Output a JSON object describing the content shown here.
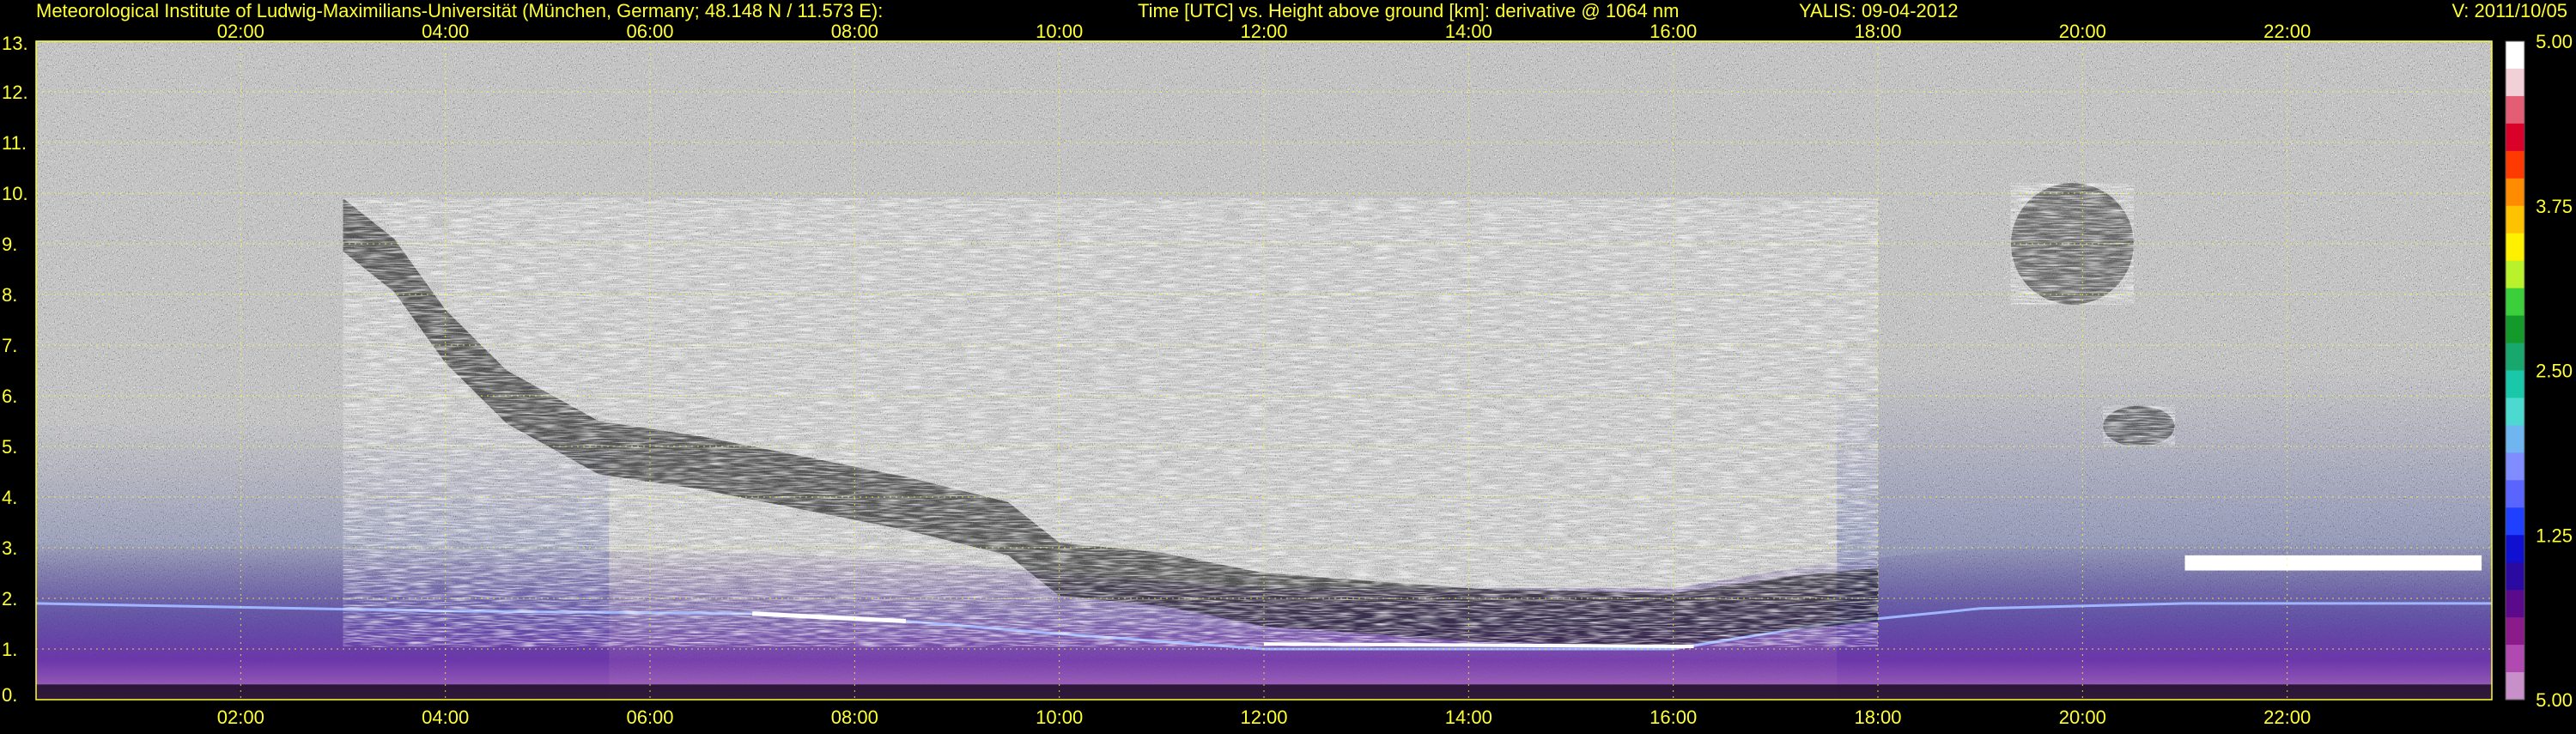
{
  "header": {
    "institute": "Meteorological Institute of Ludwig-Maximilians-Universität (München, Germany; 48.148 N / 11.573 E):",
    "title": "Time [UTC] vs. Height above ground [km]: derivative @ 1064 nm",
    "instrument": "YALIS: 09-04-2012",
    "version": "V: 2011/10/05"
  },
  "colors": {
    "label_yellow": "#ffff33",
    "background": "#000000",
    "plot_noise_gray": "#8a8a8a",
    "aerosol_purple": "#7a3fb0",
    "cloud_white": "#ffffff",
    "grid": "#ffff33"
  },
  "chart_data": {
    "type": "heatmap",
    "title": "Time [UTC] vs. Height above ground [km]: derivative @ 1064 nm",
    "xlabel": "Time [UTC]",
    "ylabel": "Height above ground [km]",
    "xlim": [
      0.0,
      24.0
    ],
    "ylim": [
      0,
      13
    ],
    "x_ticks": [
      "02:00",
      "04:00",
      "06:00",
      "08:00",
      "10:00",
      "12:00",
      "14:00",
      "16:00",
      "18:00",
      "20:00",
      "22:00"
    ],
    "x_tick_values": [
      2,
      4,
      6,
      8,
      10,
      12,
      14,
      16,
      18,
      20,
      22
    ],
    "y_ticks": [
      "0.",
      "1.",
      "2.",
      "3.",
      "4.",
      "5.",
      "6.",
      "7.",
      "8.",
      "9.",
      "10.",
      "11.",
      "12.",
      "13."
    ],
    "y_tick_values": [
      0,
      1,
      2,
      3,
      4,
      5,
      6,
      7,
      8,
      9,
      10,
      11,
      12,
      13
    ],
    "grid": true,
    "colorbar": {
      "labels": [
        "5.00",
        "3.75",
        "2.50",
        "1.25",
        "5.00"
      ],
      "colors": [
        "#ffffff",
        "#f2d0d8",
        "#e35e74",
        "#d9002a",
        "#ff3a00",
        "#ff8c00",
        "#ffc200",
        "#fff000",
        "#b9f22a",
        "#3ccf3c",
        "#149a2a",
        "#18a86e",
        "#19c8a8",
        "#4bd9d0",
        "#6fb6f0",
        "#7f8dff",
        "#5a64ff",
        "#2040ff",
        "#1010d0",
        "#2a0aa0",
        "#5a0a8a",
        "#8b1a8b",
        "#b04ab0",
        "#c890c8"
      ]
    },
    "features": {
      "aerosol_layer_top_km": [
        {
          "x": 0.0,
          "y": 1.9
        },
        {
          "x": 4.0,
          "y": 1.75
        },
        {
          "x": 7.0,
          "y": 1.7
        },
        {
          "x": 8.5,
          "y": 1.55
        },
        {
          "x": 10.0,
          "y": 1.3
        },
        {
          "x": 12.0,
          "y": 1.0
        },
        {
          "x": 14.0,
          "y": 1.0
        },
        {
          "x": 16.0,
          "y": 1.0
        },
        {
          "x": 17.5,
          "y": 1.5
        },
        {
          "x": 19.0,
          "y": 1.8
        },
        {
          "x": 21.0,
          "y": 1.9
        },
        {
          "x": 24.0,
          "y": 1.9
        }
      ],
      "descending_cloud_base_km": [
        {
          "x": 3.0,
          "y": 9.0
        },
        {
          "x": 3.5,
          "y": 8.2
        },
        {
          "x": 4.0,
          "y": 6.8
        },
        {
          "x": 4.6,
          "y": 5.6
        },
        {
          "x": 5.5,
          "y": 4.6
        },
        {
          "x": 6.5,
          "y": 4.3
        },
        {
          "x": 7.5,
          "y": 3.9
        },
        {
          "x": 8.5,
          "y": 3.5
        },
        {
          "x": 9.5,
          "y": 3.0
        },
        {
          "x": 10.0,
          "y": 2.2
        },
        {
          "x": 11.0,
          "y": 2.0
        },
        {
          "x": 12.0,
          "y": 1.6
        },
        {
          "x": 14.0,
          "y": 1.3
        },
        {
          "x": 16.0,
          "y": 1.2
        },
        {
          "x": 17.0,
          "y": 1.5
        },
        {
          "x": 18.0,
          "y": 1.7
        }
      ],
      "high_cloud_patches": [
        {
          "x_start": 19.3,
          "x_end": 20.5,
          "y_bottom": 7.8,
          "y_top": 10.2
        },
        {
          "x_start": 20.2,
          "x_end": 20.9,
          "y_bottom": 5.0,
          "y_top": 5.8
        }
      ],
      "late_cloud_layer": {
        "x_start": 21.0,
        "x_end": 23.9,
        "y": 2.7
      }
    }
  }
}
